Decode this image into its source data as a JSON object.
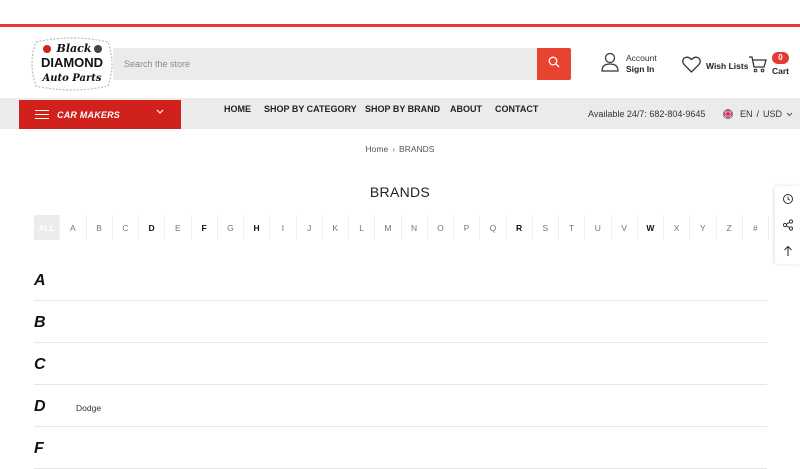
{
  "colors": {
    "accent": "#e53935",
    "nav_bg": "#ebebeb",
    "carmakers_bg": "#d0211c"
  },
  "logo": {
    "line1": "Black",
    "line2": "DIAMOND",
    "line3": "Auto Parts"
  },
  "search": {
    "placeholder": "Search the store",
    "icon": "search-icon"
  },
  "account": {
    "line1": "Account",
    "line2": "Sign In",
    "icon": "user-icon"
  },
  "wishlist": {
    "label": "Wish Lists",
    "icon": "heart-icon"
  },
  "cart": {
    "label": "Cart",
    "count": "0",
    "icon": "cart-icon"
  },
  "carmakers": {
    "label": "CAR MAKERS"
  },
  "nav": {
    "items": [
      "HOME",
      "SHOP BY CATEGORY",
      "SHOP BY BRAND",
      "ABOUT",
      "CONTACT"
    ]
  },
  "availability": "Available 24/7: 682-804-9645",
  "locale": {
    "language": "EN",
    "separator": "/",
    "currency": "USD"
  },
  "breadcrumb": {
    "home": "Home",
    "current": "BRANDS"
  },
  "page_title": "BRANDS",
  "alphabet": [
    "ALL",
    "A",
    "B",
    "C",
    "D",
    "E",
    "F",
    "G",
    "H",
    "I",
    "J",
    "K",
    "L",
    "M",
    "N",
    "O",
    "P",
    "Q",
    "R",
    "S",
    "T",
    "U",
    "V",
    "W",
    "X",
    "Y",
    "Z",
    "#"
  ],
  "alphabet_bold": [
    "D",
    "F",
    "H",
    "R",
    "W"
  ],
  "groups": [
    {
      "letter": "A",
      "brands": []
    },
    {
      "letter": "B",
      "brands": []
    },
    {
      "letter": "C",
      "brands": []
    },
    {
      "letter": "D",
      "brands": [
        "Dodge"
      ]
    },
    {
      "letter": "F",
      "brands": []
    }
  ]
}
